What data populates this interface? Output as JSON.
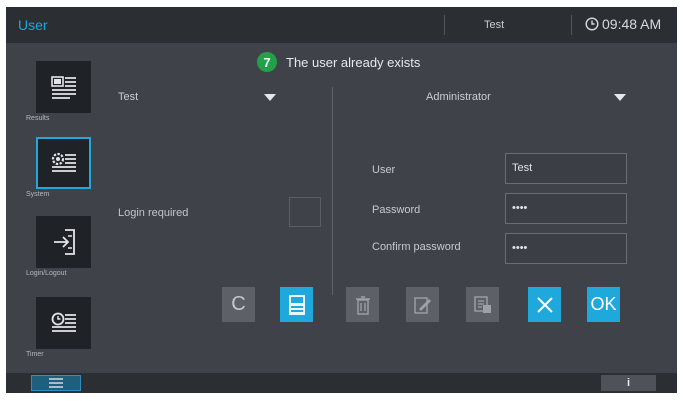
{
  "titlebar": {
    "app_title": "User",
    "current_user": "Test",
    "time": "09:48 AM",
    "clock_icon": "clock-icon"
  },
  "message": {
    "number": "7",
    "text": "The user already exists"
  },
  "sidebar": {
    "items": [
      {
        "label": "Results",
        "icon": "results-icon",
        "active": false
      },
      {
        "label": "System",
        "icon": "system-icon",
        "active": true
      },
      {
        "label": "Login/Logout",
        "icon": "login-logout-icon",
        "active": false
      },
      {
        "label": "Timer",
        "icon": "timer-icon",
        "active": false
      }
    ]
  },
  "left_panel": {
    "user_select_value": "Test",
    "login_required_label": "Login required",
    "login_required_checked": false
  },
  "right_panel": {
    "role_select_value": "Administrator",
    "fields": {
      "user_label": "User",
      "user_value": "Test",
      "password_label": "Password",
      "password_value": "••••",
      "confirm_label": "Confirm password",
      "confirm_value": "••••"
    }
  },
  "actions": {
    "clear_label": "C",
    "ok_label": "OK",
    "icons": [
      "clear-icon",
      "save-icon",
      "delete-icon",
      "edit-icon",
      "copy-icon",
      "cancel-icon",
      "ok-icon"
    ]
  },
  "bottombar": {
    "info_label": "i"
  },
  "colors": {
    "accent": "#1ea8dc",
    "background": "#3f4349",
    "bar": "#2b2e33",
    "message_badge": "#23a14a"
  }
}
